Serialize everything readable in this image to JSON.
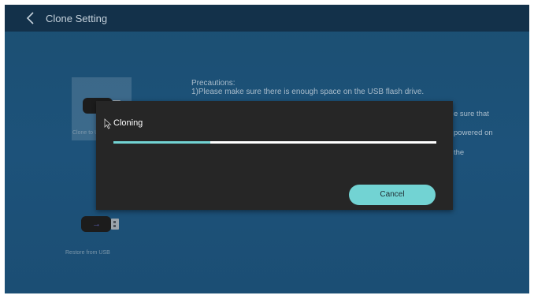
{
  "header": {
    "title": "Clone Setting",
    "back_icon": "chevron-left-icon"
  },
  "background": {
    "clone_tile_label": "Clone to USB",
    "restore_tile_label": "Restore from USB",
    "precautions_title": "Precautions:",
    "precaution_1": "1)Please make sure there is enough space on the USB flash drive.",
    "side_text_1": "e sure that",
    "side_text_2": "powered on",
    "side_text_3": "the"
  },
  "dialog": {
    "title": "Cloning",
    "progress": 0.3,
    "cancel_label": "Cancel"
  },
  "colors": {
    "accent": "#72d3d3",
    "screen_bg": "#1b4f72",
    "topbar_bg": "#13314a",
    "dialog_bg": "#262626"
  }
}
